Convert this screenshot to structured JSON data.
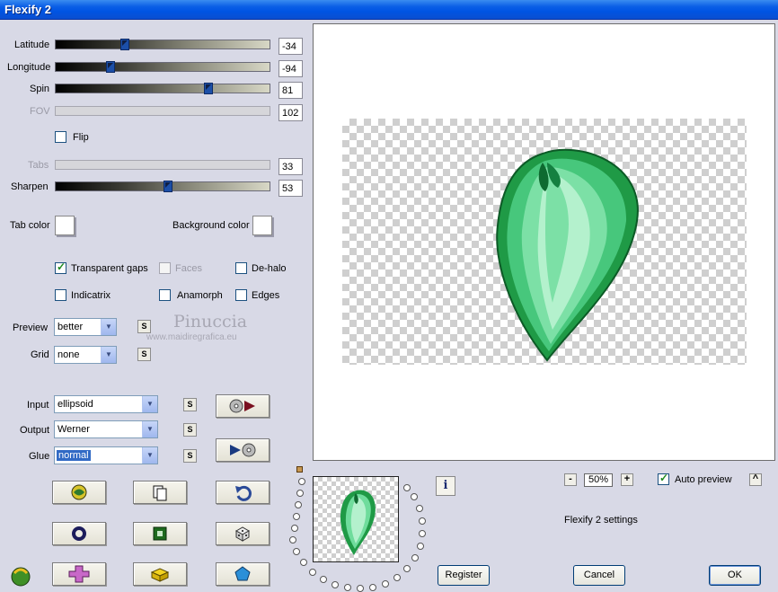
{
  "window": {
    "title": "Flexify 2"
  },
  "sliders": {
    "latitude": {
      "label": "Latitude",
      "value": "-34",
      "fraction": 0.33
    },
    "longitude": {
      "label": "Longitude",
      "value": "-94",
      "fraction": 0.25
    },
    "spin": {
      "label": "Spin",
      "value": "81",
      "fraction": 0.71
    },
    "fov": {
      "label": "FOV",
      "value": "102"
    },
    "tabs": {
      "label": "Tabs",
      "value": "33"
    },
    "sharpen": {
      "label": "Sharpen",
      "value": "53",
      "fraction": 0.52
    }
  },
  "flip": {
    "label": "Flip",
    "checked": false
  },
  "colors": {
    "tab_color_label": "Tab color",
    "background_color_label": "Background color",
    "tab_color": "#ffffff",
    "background_color": "#ffffff"
  },
  "options": {
    "transparent_gaps": {
      "label": "Transparent gaps",
      "checked": true
    },
    "faces": {
      "label": "Faces",
      "checked": false
    },
    "de_halo": {
      "label": "De-halo",
      "checked": false
    },
    "indicatrix": {
      "label": "Indicatrix",
      "checked": false
    },
    "anamorph": {
      "label": "Anamorph",
      "checked": false
    },
    "edges": {
      "label": "Edges",
      "checked": false
    }
  },
  "preview_select": {
    "label": "Preview",
    "value": "better"
  },
  "grid_select": {
    "label": "Grid",
    "value": "none"
  },
  "input_select": {
    "label": "Input",
    "value": "ellipsoid"
  },
  "output_select": {
    "label": "Output",
    "value": "Werner"
  },
  "glue_select": {
    "label": "Glue",
    "value": "normal"
  },
  "small_button_label": "S",
  "watermark": {
    "name": "Pinuccia",
    "site": "www.maidiregrafica.eu"
  },
  "zoom": {
    "value": "50%",
    "minus": "-",
    "plus": "+"
  },
  "auto_preview": {
    "label": "Auto preview",
    "checked": true
  },
  "caret_label": "^",
  "settings_name": "Flexify 2 settings",
  "buttons": {
    "register": "Register",
    "cancel": "Cancel",
    "ok": "OK"
  },
  "icons": {
    "random": "globe-random-icon",
    "copy": "copy-icon",
    "undo": "undo-icon",
    "ring": "ring-icon",
    "square": "square-icon",
    "dice": "dice-icon",
    "plus": "plus-icon",
    "block": "block-icon",
    "gem": "pentagon-icon",
    "play_left": "disc-play-icon",
    "play_right": "play-disc-icon",
    "info": "info-icon"
  },
  "accent": {
    "title_blue": "#0054e3",
    "gem_green": "#1fa35a"
  }
}
